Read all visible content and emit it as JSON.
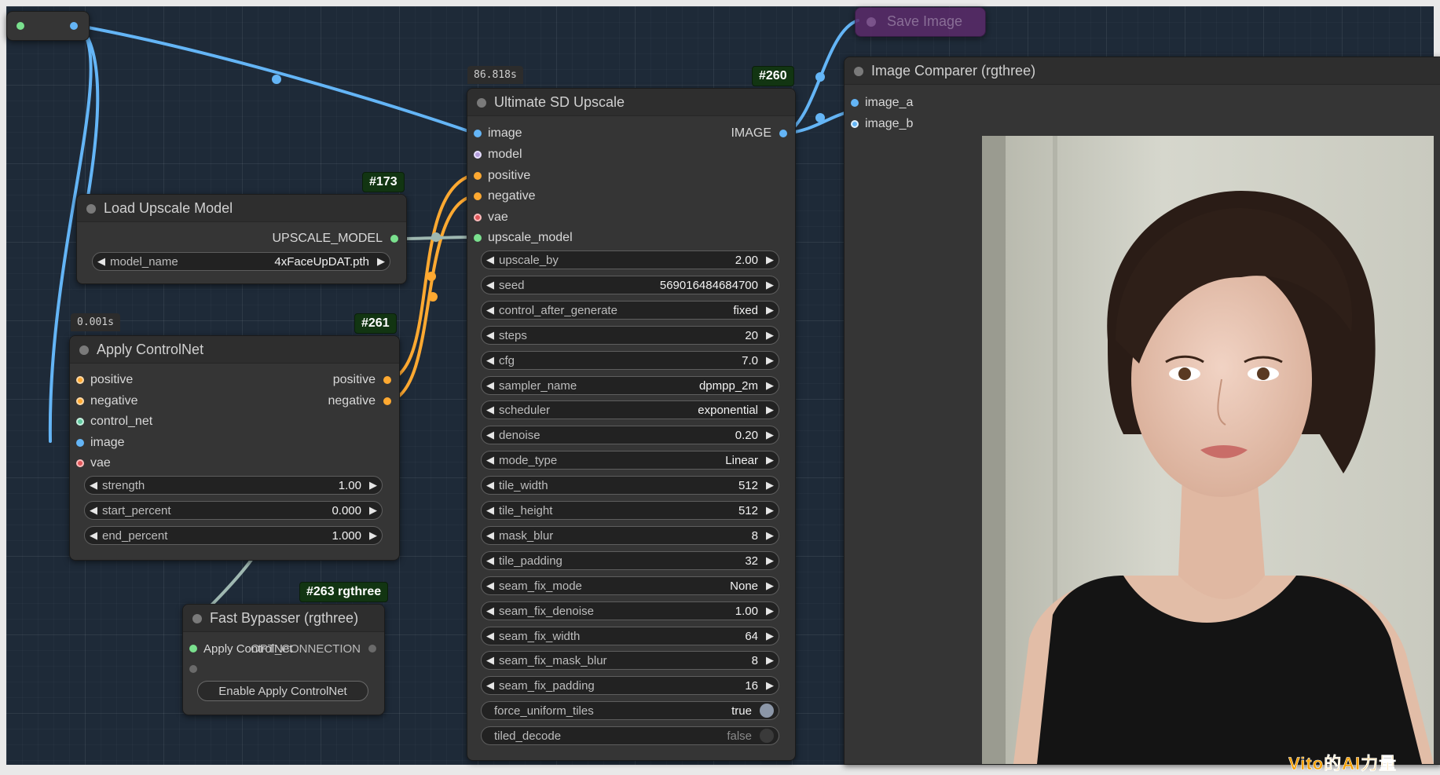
{
  "colors": {
    "canvas_bg": "#1e2a38",
    "node_bg": "#353535",
    "badge_bg": "#123512",
    "wire_image": "#64b5f6",
    "wire_conditioning": "#ffa931",
    "wire_upscale_model": "#9fb8b1",
    "save_image_node": "#5a2a6a"
  },
  "reroute": {
    "input_color": "#7ae08e",
    "output_color": "#64b5f6"
  },
  "save_image": {
    "title": "Save Image"
  },
  "ultimate_sd_upscale": {
    "timer": "86.818s",
    "badge": "#260",
    "title": "Ultimate SD Upscale",
    "inputs": [
      {
        "label": "image",
        "color": "blue"
      },
      {
        "label": "model",
        "color": "purple"
      },
      {
        "label": "positive",
        "color": "orange"
      },
      {
        "label": "negative",
        "color": "orange"
      },
      {
        "label": "vae",
        "color": "red"
      },
      {
        "label": "upscale_model",
        "color": "green"
      }
    ],
    "output": {
      "label": "IMAGE"
    },
    "widgets": [
      {
        "name": "upscale_by",
        "value": "2.00"
      },
      {
        "name": "seed",
        "value": "569016484684700"
      },
      {
        "name": "control_after_generate",
        "value": "fixed"
      },
      {
        "name": "steps",
        "value": "20"
      },
      {
        "name": "cfg",
        "value": "7.0"
      },
      {
        "name": "sampler_name",
        "value": "dpmpp_2m"
      },
      {
        "name": "scheduler",
        "value": "exponential"
      },
      {
        "name": "denoise",
        "value": "0.20"
      },
      {
        "name": "mode_type",
        "value": "Linear"
      },
      {
        "name": "tile_width",
        "value": "512"
      },
      {
        "name": "tile_height",
        "value": "512"
      },
      {
        "name": "mask_blur",
        "value": "8"
      },
      {
        "name": "tile_padding",
        "value": "32"
      },
      {
        "name": "seam_fix_mode",
        "value": "None"
      },
      {
        "name": "seam_fix_denoise",
        "value": "1.00"
      },
      {
        "name": "seam_fix_width",
        "value": "64"
      },
      {
        "name": "seam_fix_mask_blur",
        "value": "8"
      },
      {
        "name": "seam_fix_padding",
        "value": "16"
      }
    ],
    "toggles": [
      {
        "name": "force_uniform_tiles",
        "value": "true",
        "on": true
      },
      {
        "name": "tiled_decode",
        "value": "false",
        "on": false
      }
    ]
  },
  "load_upscale_model": {
    "badge": "#173",
    "title": "Load Upscale Model",
    "output": {
      "label": "UPSCALE_MODEL"
    },
    "widgets": [
      {
        "name": "model_name",
        "value": "4xFaceUpDAT.pth"
      }
    ]
  },
  "apply_controlnet": {
    "timer": "0.001s",
    "badge": "#261",
    "title": "Apply ControlNet",
    "inputs": [
      {
        "label": "positive",
        "color": "orange"
      },
      {
        "label": "negative",
        "color": "orange"
      },
      {
        "label": "control_net",
        "color": "teal"
      },
      {
        "label": "image",
        "color": "blue"
      },
      {
        "label": "vae",
        "color": "red"
      }
    ],
    "outputs": [
      {
        "label": "positive"
      },
      {
        "label": "negative"
      }
    ],
    "widgets": [
      {
        "name": "strength",
        "value": "1.00"
      },
      {
        "name": "start_percent",
        "value": "0.000"
      },
      {
        "name": "end_percent",
        "value": "1.000"
      }
    ]
  },
  "fast_bypasser": {
    "badge": "#263 rgthree",
    "title": "Fast Bypasser (rgthree)",
    "input_label": "Apply ControlNet",
    "output_label": "OPT_CONNECTION",
    "button_label": "Enable Apply ControlNet"
  },
  "image_comparer": {
    "title": "Image Comparer (rgthree)",
    "inputs": [
      {
        "label": "image_a",
        "color": "blue"
      },
      {
        "label": "image_b",
        "color": "blue"
      }
    ]
  },
  "watermark": "Vito的AI力量"
}
